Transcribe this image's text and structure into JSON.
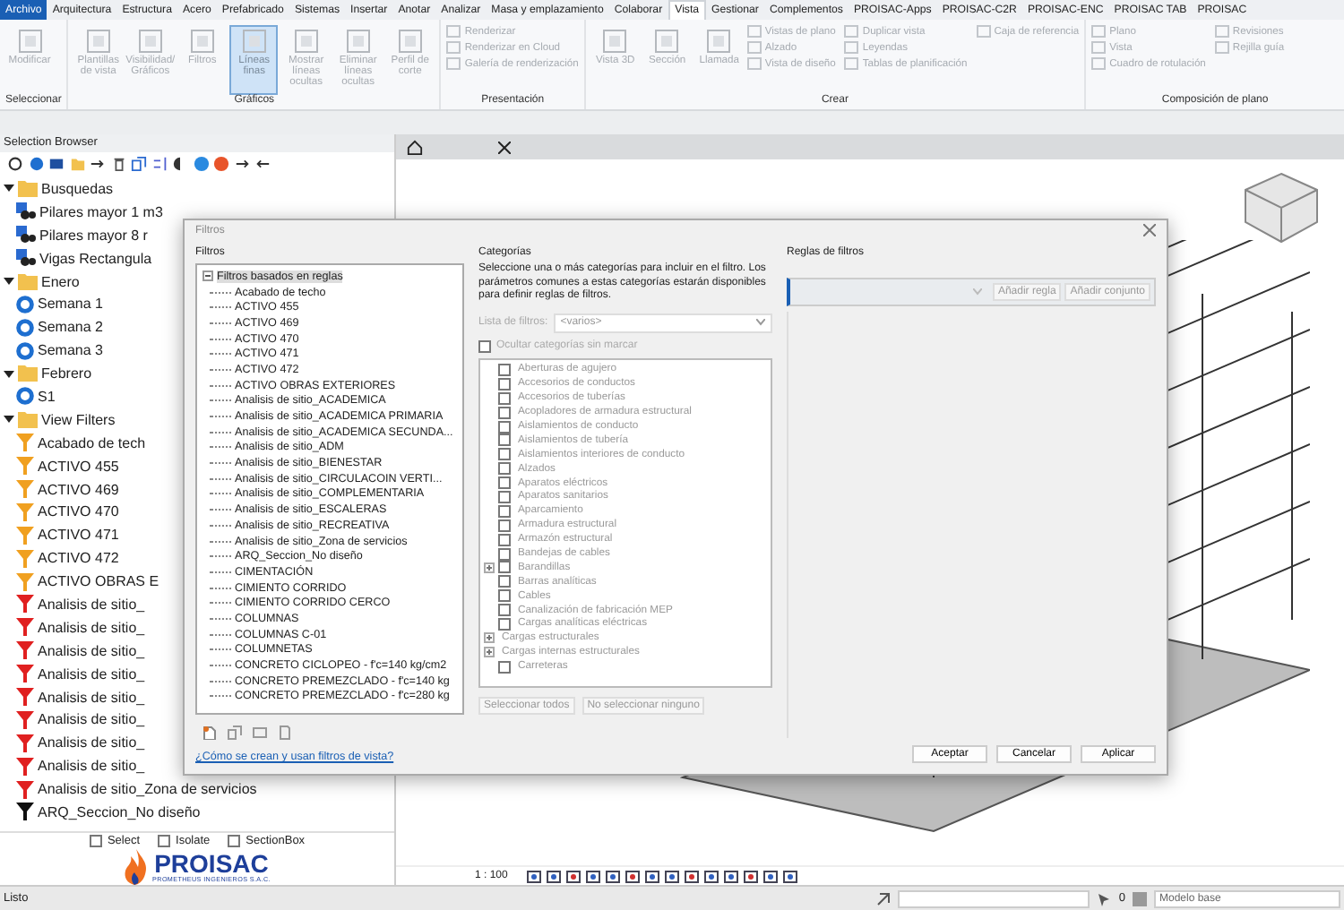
{
  "menu_tabs": [
    {
      "label": "Archivo",
      "kind": "file",
      "selected": false
    },
    {
      "label": "Arquitectura",
      "kind": "tab",
      "selected": false
    },
    {
      "label": "Estructura",
      "kind": "tab",
      "selected": false
    },
    {
      "label": "Acero",
      "kind": "tab",
      "selected": false
    },
    {
      "label": "Prefabricado",
      "kind": "tab",
      "selected": false
    },
    {
      "label": "Sistemas",
      "kind": "tab",
      "selected": false
    },
    {
      "label": "Insertar",
      "kind": "tab",
      "selected": false
    },
    {
      "label": "Anotar",
      "kind": "tab",
      "selected": false
    },
    {
      "label": "Analizar",
      "kind": "tab",
      "selected": false
    },
    {
      "label": "Masa y emplazamiento",
      "kind": "tab",
      "selected": false
    },
    {
      "label": "Colaborar",
      "kind": "tab",
      "selected": false
    },
    {
      "label": "Vista",
      "kind": "tab",
      "selected": true
    },
    {
      "label": "Gestionar",
      "kind": "tab",
      "selected": false
    },
    {
      "label": "Complementos",
      "kind": "tab",
      "selected": false
    },
    {
      "label": "PROISAC-Apps",
      "kind": "tab",
      "selected": false
    },
    {
      "label": "PROISAC-C2R",
      "kind": "tab",
      "selected": false
    },
    {
      "label": "PROISAC-ENC",
      "kind": "tab",
      "selected": false
    },
    {
      "label": "PROISAC TAB",
      "kind": "tab",
      "selected": false
    },
    {
      "label": "PROISAC",
      "kind": "tab",
      "selected": false
    }
  ],
  "ribbon": {
    "panels": [
      {
        "title": "Seleccionar",
        "large": [
          {
            "label": "Modificar",
            "on": false
          }
        ]
      },
      {
        "title": "Gráficos",
        "large": [
          {
            "label": "Plantillas de vista",
            "on": false
          },
          {
            "label": "Visibilidad/ Gráficos",
            "on": false
          },
          {
            "label": "Filtros",
            "on": false
          },
          {
            "label": "Líneas finas",
            "on": true
          },
          {
            "label": "Mostrar líneas ocultas",
            "on": false
          },
          {
            "label": "Eliminar líneas ocultas",
            "on": false
          },
          {
            "label": "Perfil de corte",
            "on": false
          }
        ]
      },
      {
        "title": "Presentación",
        "small": [
          "Renderizar",
          "Renderizar en Cloud",
          "Galería de renderización"
        ]
      },
      {
        "title": "Crear",
        "large": [
          {
            "label": "Vista 3D",
            "on": false
          },
          {
            "label": "Sección",
            "on": false
          },
          {
            "label": "Llamada",
            "on": false
          }
        ],
        "small": [
          "Vistas de plano",
          "Alzado",
          "Vista de diseño",
          "Duplicar vista",
          "Leyendas",
          "Tablas de planificación",
          "Caja de referencia"
        ]
      },
      {
        "title": "Composición de plano",
        "small": [
          "Plano",
          "Vista",
          "Cuadro de rotulación",
          "Revisiones",
          "Rejilla guía"
        ]
      }
    ]
  },
  "browser": {
    "title": "Selection Browser",
    "tree": [
      {
        "label": "Busquedas",
        "expanded": true,
        "children": [
          {
            "label": "Pilares mayor 1 m3",
            "kind": "search"
          },
          {
            "label": "Pilares mayor 8 r",
            "kind": "search"
          },
          {
            "label": "Vigas Rectangula",
            "kind": "search"
          }
        ]
      },
      {
        "label": "Enero",
        "expanded": true,
        "children": [
          {
            "label": "Semana 1",
            "kind": "set"
          },
          {
            "label": "Semana 2",
            "kind": "set"
          },
          {
            "label": "Semana 3",
            "kind": "set"
          }
        ]
      },
      {
        "label": "Febrero",
        "expanded": true,
        "children": [
          {
            "label": "S1",
            "kind": "set"
          }
        ]
      },
      {
        "label": "View Filters",
        "expanded": true,
        "children": [
          {
            "label": "Acabado de tech",
            "kind": "filter",
            "color": "#f0a020"
          },
          {
            "label": "ACTIVO 455",
            "kind": "filter",
            "color": "#f0a020"
          },
          {
            "label": "ACTIVO 469",
            "kind": "filter",
            "color": "#f0a020"
          },
          {
            "label": "ACTIVO 470",
            "kind": "filter",
            "color": "#f0a020"
          },
          {
            "label": "ACTIVO 471",
            "kind": "filter",
            "color": "#f0a020"
          },
          {
            "label": "ACTIVO 472",
            "kind": "filter",
            "color": "#f0a020"
          },
          {
            "label": "ACTIVO OBRAS E",
            "kind": "filter",
            "color": "#f0a020"
          },
          {
            "label": "Analisis de sitio_",
            "kind": "filter",
            "color": "#e02020"
          },
          {
            "label": "Analisis de sitio_",
            "kind": "filter",
            "color": "#e02020"
          },
          {
            "label": "Analisis de sitio_",
            "kind": "filter",
            "color": "#e02020"
          },
          {
            "label": "Analisis de sitio_",
            "kind": "filter",
            "color": "#e02020"
          },
          {
            "label": "Analisis de sitio_",
            "kind": "filter",
            "color": "#e02020"
          },
          {
            "label": "Analisis de sitio_",
            "kind": "filter",
            "color": "#e02020"
          },
          {
            "label": "Analisis de sitio_",
            "kind": "filter",
            "color": "#e02020"
          },
          {
            "label": "Analisis de sitio_",
            "kind": "filter",
            "color": "#e02020"
          },
          {
            "label": "Analisis de sitio_Zona de servicios",
            "kind": "filter",
            "color": "#e02020"
          },
          {
            "label": "ARQ_Seccion_No diseño",
            "kind": "filter",
            "color": "#101010"
          }
        ]
      }
    ],
    "options": [
      {
        "label": "Select",
        "checked": false
      },
      {
        "label": "Isolate",
        "checked": false
      },
      {
        "label": "SectionBox",
        "checked": false
      }
    ],
    "logo": {
      "name": "PROISAC",
      "tagline": "PROMETHEUS INGENIEROS S.A.C."
    }
  },
  "view": {
    "scale": "1 : 100"
  },
  "dialog": {
    "title": "Filtros",
    "filters": {
      "heading": "Filtros",
      "tree": [
        {
          "label": "Filtros basados en reglas",
          "expanded": true,
          "selected": true,
          "children": [
            {
              "label": "Acabado de techo",
              "selected": false
            },
            {
              "label": "ACTIVO 455",
              "selected": false
            },
            {
              "label": "ACTIVO 469",
              "selected": false
            },
            {
              "label": "ACTIVO 470",
              "selected": false
            },
            {
              "label": "ACTIVO 471",
              "selected": false
            },
            {
              "label": "ACTIVO 472",
              "selected": false
            },
            {
              "label": "ACTIVO OBRAS EXTERIORES",
              "selected": false
            },
            {
              "label": "Analisis de sitio_ACADEMICA",
              "selected": false
            },
            {
              "label": "Analisis de sitio_ACADEMICA PRIMARIA",
              "selected": false
            },
            {
              "label": "Analisis de sitio_ACADEMICA SECUNDA...",
              "selected": false
            },
            {
              "label": "Analisis de sitio_ADM",
              "selected": false
            },
            {
              "label": "Analisis de sitio_BIENESTAR",
              "selected": false
            },
            {
              "label": "Analisis de sitio_CIRCULACOIN VERTI...",
              "selected": false
            },
            {
              "label": "Analisis de sitio_COMPLEMENTARIA",
              "selected": false
            },
            {
              "label": "Analisis de sitio_ESCALERAS",
              "selected": false
            },
            {
              "label": "Analisis de sitio_RECREATIVA",
              "selected": false
            },
            {
              "label": "Analisis de sitio_Zona de servicios",
              "selected": false
            },
            {
              "label": "ARQ_Seccion_No diseño",
              "selected": false
            },
            {
              "label": "CIMENTACIÓN",
              "selected": false
            },
            {
              "label": "CIMIENTO CORRIDO",
              "selected": false
            },
            {
              "label": "CIMIENTO CORRIDO CERCO",
              "selected": false
            },
            {
              "label": "COLUMNAS",
              "selected": false
            },
            {
              "label": "COLUMNAS C-01",
              "selected": false
            },
            {
              "label": "COLUMNETAS",
              "selected": false
            },
            {
              "label": "CONCRETO CICLOPEO - f'c=140 kg/cm2",
              "selected": false
            },
            {
              "label": "CONCRETO PREMEZCLADO - f'c=140 kg",
              "selected": false
            },
            {
              "label": "CONCRETO PREMEZCLADO - f'c=280 kg",
              "selected": false
            }
          ]
        }
      ],
      "help_link": "¿Cómo se crean y usan filtros de vista?"
    },
    "categories": {
      "heading": "Categorías",
      "description": "Seleccione una o más categorías para incluir en el filtro. Los parámetros comunes a estas categorías estarán disponibles para definir reglas de filtros.",
      "filter_list_label": "Lista de filtros:",
      "filter_list_value": "<varios>",
      "hide_unchecked": {
        "label": "Ocultar categorías sin marcar",
        "checked": false
      },
      "items": [
        {
          "label": "Aberturas de agujero",
          "kind": "checkbox",
          "checked": false
        },
        {
          "label": "Accesorios de conductos",
          "kind": "checkbox",
          "checked": false
        },
        {
          "label": "Accesorios de tuberías",
          "kind": "checkbox",
          "checked": false
        },
        {
          "label": "Acopladores de armadura estructural",
          "kind": "checkbox",
          "checked": false
        },
        {
          "label": "Aislamientos de conducto",
          "kind": "checkbox",
          "checked": false
        },
        {
          "label": "Aislamientos de tubería",
          "kind": "checkbox",
          "checked": false
        },
        {
          "label": "Aislamientos interiores de conducto",
          "kind": "checkbox",
          "checked": false
        },
        {
          "label": "Alzados",
          "kind": "checkbox",
          "checked": false
        },
        {
          "label": "Aparatos eléctricos",
          "kind": "checkbox",
          "checked": false
        },
        {
          "label": "Aparatos sanitarios",
          "kind": "checkbox",
          "checked": false
        },
        {
          "label": "Aparcamiento",
          "kind": "checkbox",
          "checked": false
        },
        {
          "label": "Armadura estructural",
          "kind": "checkbox",
          "checked": false
        },
        {
          "label": "Armazón estructural",
          "kind": "checkbox",
          "checked": false
        },
        {
          "label": "Bandejas de cables",
          "kind": "checkbox",
          "checked": false
        },
        {
          "label": "Barandillas",
          "kind": "checkbox_group",
          "checked": false,
          "expanded": false
        },
        {
          "label": "Barras analíticas",
          "kind": "checkbox",
          "checked": false
        },
        {
          "label": "Cables",
          "kind": "checkbox",
          "checked": false
        },
        {
          "label": "Canalización de fabricación MEP",
          "kind": "checkbox",
          "checked": false
        },
        {
          "label": "Cargas analíticas eléctricas",
          "kind": "checkbox",
          "checked": false
        },
        {
          "label": "Cargas estructurales",
          "kind": "group",
          "expanded": false
        },
        {
          "label": "Cargas internas estructurales",
          "kind": "group",
          "expanded": false
        },
        {
          "label": "Carreteras",
          "kind": "checkbox",
          "checked": false
        }
      ],
      "buttons": [
        "Seleccionar todos",
        "No seleccionar ninguno"
      ]
    },
    "rules": {
      "heading": "Reglas de filtros",
      "buttons": [
        "Añadir regla",
        "Añadir conjunto"
      ]
    },
    "buttons": [
      "Aceptar",
      "Cancelar",
      "Aplicar"
    ]
  },
  "status_bar": {
    "text": "Listo",
    "count": "0",
    "workset": "Modelo base"
  }
}
